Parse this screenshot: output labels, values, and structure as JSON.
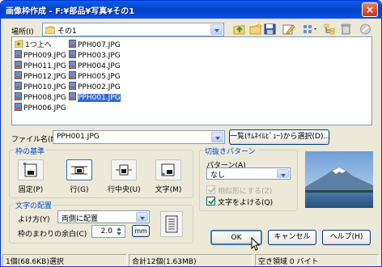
{
  "window": {
    "title": "画像枠作成 - F:¥部品¥写真¥その1"
  },
  "location": {
    "label": "場所(I)",
    "value": "その1"
  },
  "files": {
    "up_label": "1つ上へ",
    "col1": [
      "PPH009.JPG",
      "PPH011.JPG",
      "PPH012.JPG",
      "PPH010.JPG",
      "PPH008.JPG",
      "PPH006.JPG"
    ],
    "col2": [
      "PPH007.JPG",
      "PPH003.JPG",
      "PPH004.JPG",
      "PPH005.JPG",
      "PPH002.JPG",
      "PPH001.JPG"
    ],
    "selected": "PPH001.JPG"
  },
  "filename": {
    "label": "ファイル名(N)",
    "value": "PPH001.JPG"
  },
  "thumb_select_button": "一覧(ｻﾑﾈｲﾙﾋﾞｭｰ)から選択(D)...",
  "frame_base": {
    "title": "枠の基準",
    "options": [
      "固定(P)",
      "行(G)",
      "行中央(U)",
      "文字(M)"
    ],
    "selected_index": 1
  },
  "text_layout": {
    "title": "文字の配置",
    "wrap_label": "よけ方(Y)",
    "wrap_value": "両側に配置",
    "margin_label": "枠のまわりの余白(C)",
    "margin_value": "2.0",
    "margin_unit": "mm"
  },
  "crop_pattern": {
    "title": "切抜きパターン",
    "pattern_label": "パターン(A)",
    "pattern_value": "なし",
    "similar_label": "相似形にする(Z)",
    "similar_checked": true,
    "similar_enabled": false,
    "avoid_text_label": "文字をよける(Q)",
    "avoid_text_checked": true
  },
  "buttons": {
    "ok": "OK",
    "cancel": "キャンセル",
    "help": "ヘルプ(H)"
  },
  "status": {
    "left": "1個(68.6KB)選択",
    "middle": "合計12個(1.63MB)",
    "right": "空き領域 0 バイト"
  },
  "colors": {
    "title_bar": "#0a5fe8",
    "selection": "#316ac5",
    "group_title": "#0046d5"
  }
}
